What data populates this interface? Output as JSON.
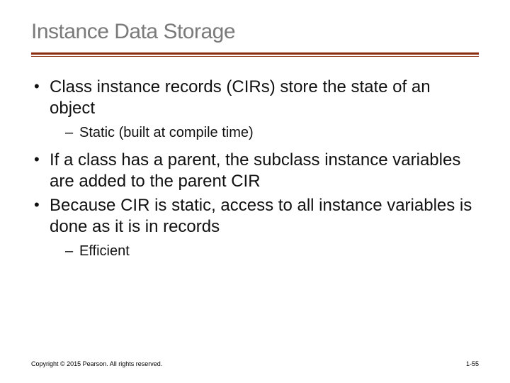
{
  "slide": {
    "title": "Instance Data Storage",
    "bullets": [
      {
        "text": "Class instance records (CIRs) store the state of an object",
        "sub": [
          "Static (built at compile time)"
        ]
      },
      {
        "text": "If a class has a parent, the subclass instance variables are added to the parent CIR",
        "sub": []
      },
      {
        "text": "Because CIR is static, access to all instance variables is done as it is in records",
        "sub": [
          "Efficient"
        ]
      }
    ],
    "footer": "Copyright © 2015 Pearson. All rights reserved.",
    "page": "1-55"
  }
}
